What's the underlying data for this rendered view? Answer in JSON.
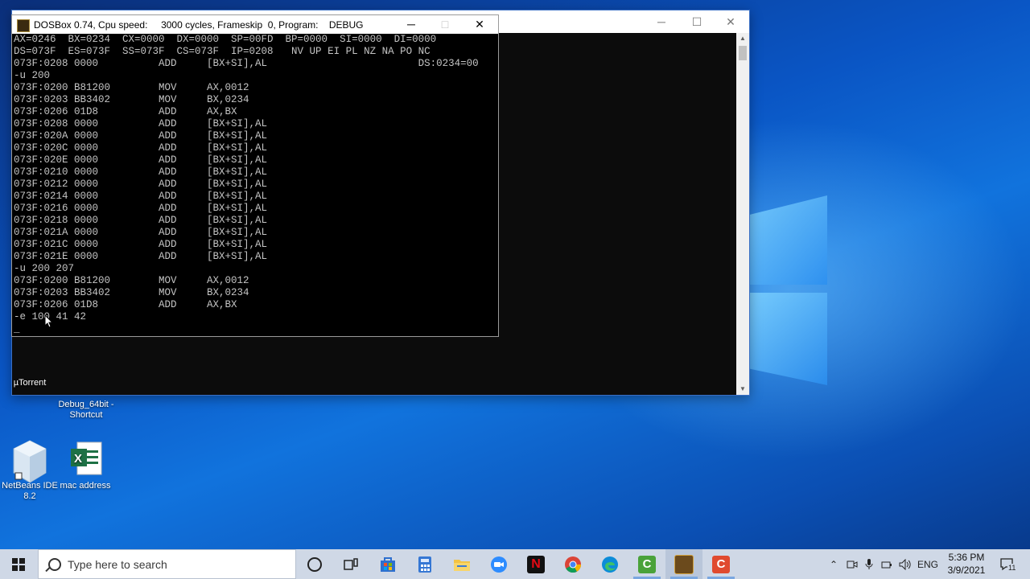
{
  "dosbox": {
    "title": "DOSBox 0.74, Cpu speed:     3000 cycles, Frameskip  0, Program:    DEBUG",
    "minimize": "─",
    "maximize": "□",
    "close": "✕",
    "lines": [
      "AX=0246  BX=0234  CX=0000  DX=0000  SP=00FD  BP=0000  SI=0000  DI=0000",
      "DS=073F  ES=073F  SS=073F  CS=073F  IP=0208   NV UP EI PL NZ NA PO NC",
      "073F:0208 0000          ADD     [BX+SI],AL                         DS:0234=00",
      "-u 200",
      "073F:0200 B81200        MOV     AX,0012",
      "073F:0203 BB3402        MOV     BX,0234",
      "073F:0206 01D8          ADD     AX,BX",
      "073F:0208 0000          ADD     [BX+SI],AL",
      "073F:020A 0000          ADD     [BX+SI],AL",
      "073F:020C 0000          ADD     [BX+SI],AL",
      "073F:020E 0000          ADD     [BX+SI],AL",
      "073F:0210 0000          ADD     [BX+SI],AL",
      "073F:0212 0000          ADD     [BX+SI],AL",
      "073F:0214 0000          ADD     [BX+SI],AL",
      "073F:0216 0000          ADD     [BX+SI],AL",
      "073F:0218 0000          ADD     [BX+SI],AL",
      "073F:021A 0000          ADD     [BX+SI],AL",
      "073F:021C 0000          ADD     [BX+SI],AL",
      "073F:021E 0000          ADD     [BX+SI],AL",
      "-u 200 207",
      "073F:0200 B81200        MOV     AX,0012",
      "073F:0203 BB3402        MOV     BX,0234",
      "073F:0206 01D8          ADD     AX,BX",
      "-e 100 41 42",
      "_"
    ]
  },
  "desktop_icons": [
    {
      "label": "µTorrent"
    },
    {
      "label": "Debug_64bit - Shortcut"
    },
    {
      "label": "NetBeans IDE 8.2"
    },
    {
      "label": "mac address"
    }
  ],
  "taskbar": {
    "search_placeholder": "Type here to search",
    "apps": [
      "cortana",
      "task-view",
      "store",
      "calculator",
      "file-explorer",
      "zoom",
      "netflix",
      "chrome",
      "edge",
      "camtasia",
      "dosbox",
      "camtasia-recorder"
    ],
    "tray": {
      "language": "ENG",
      "time": "5:36 PM",
      "date": "3/9/2021",
      "notifications": "11"
    }
  },
  "colors": {
    "terminal_text": "#c4c4c4",
    "terminal_bg": "#000000",
    "taskbar": "#cfd8e6"
  }
}
